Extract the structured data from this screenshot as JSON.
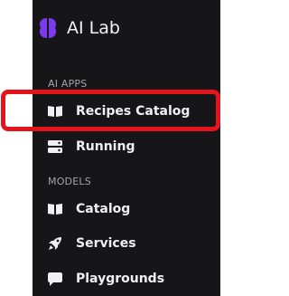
{
  "app": {
    "title": "AI Lab",
    "brand_icon": "brain-icon",
    "brand_color": "#7c3aed"
  },
  "sections": [
    {
      "heading": "AI APPS",
      "items": [
        {
          "label": "Recipes Catalog",
          "icon": "book-open-icon",
          "highlighted": true
        },
        {
          "label": "Running",
          "icon": "server-icon"
        }
      ]
    },
    {
      "heading": "MODELS",
      "items": [
        {
          "label": "Catalog",
          "icon": "book-open-icon"
        },
        {
          "label": "Services",
          "icon": "rocket-icon"
        },
        {
          "label": "Playgrounds",
          "icon": "message-icon"
        }
      ]
    }
  ],
  "colors": {
    "sidebar_bg": "#161619",
    "highlight_border": "#e5131c",
    "text": "#f0f0f2",
    "heading_text": "#a3a3ad"
  }
}
